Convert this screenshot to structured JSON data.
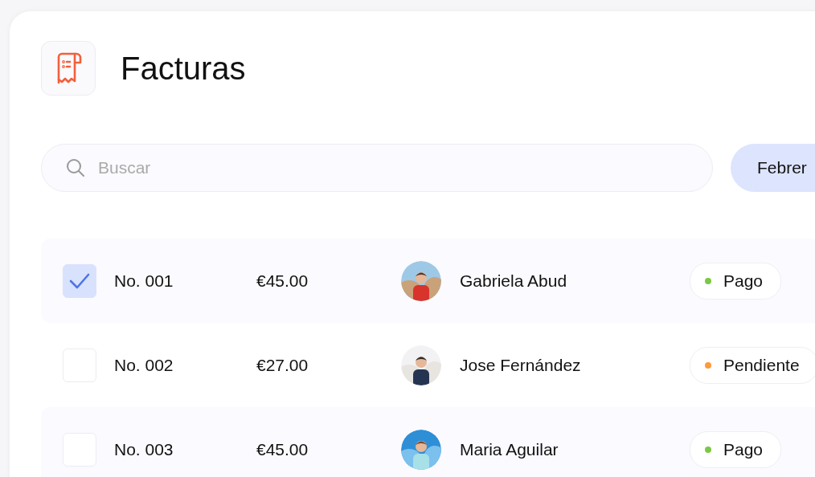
{
  "header": {
    "title": "Facturas"
  },
  "search": {
    "placeholder": "Buscar"
  },
  "month_button": {
    "label": "Febrer"
  },
  "invoices": [
    {
      "selected": true,
      "number": "No. 001",
      "amount": "€45.00",
      "customer": "Gabriela Abud",
      "status": "Pago",
      "color": "#7ac943"
    },
    {
      "selected": false,
      "number": "No. 002",
      "amount": "€27.00",
      "customer": "Jose Fernández",
      "status": "Pendiente",
      "color": "#ff9a3c"
    },
    {
      "selected": false,
      "number": "No. 003",
      "amount": "€45.00",
      "customer": "Maria Aguilar",
      "status": "Pago",
      "color": "#7ac943"
    }
  ]
}
